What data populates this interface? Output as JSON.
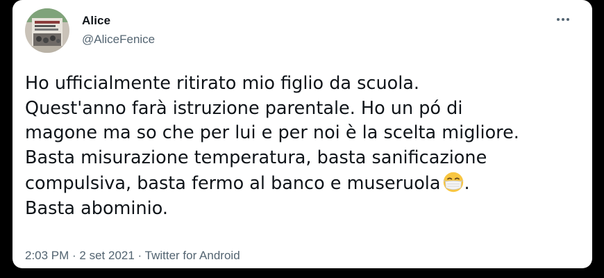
{
  "author": {
    "name": "Alice",
    "handle": "@AliceFenice",
    "avatar_icon": "profile-photo"
  },
  "more_icon": "more-options-icon",
  "tweet": {
    "lines": [
      "Ho ufficialmente ritirato mio figlio da scuola.",
      "Quest'anno farà istruzione parentale. Ho un pó di",
      "magone ma so che per lui e per noi è la scelta migliore.",
      "Basta misurazione temperatura, basta sanificazione",
      "compulsiva, basta fermo al banco e museruola",
      "Basta abominio."
    ],
    "line5_suffix": ".",
    "emoji": "face-with-medical-mask"
  },
  "meta": {
    "time": "2:03 PM",
    "separator": " · ",
    "date": "2 set 2021",
    "source": "Twitter for Android"
  },
  "colors": {
    "text": "#0f1419",
    "secondary": "#536471",
    "background": "#000000",
    "card": "#ffffff"
  }
}
